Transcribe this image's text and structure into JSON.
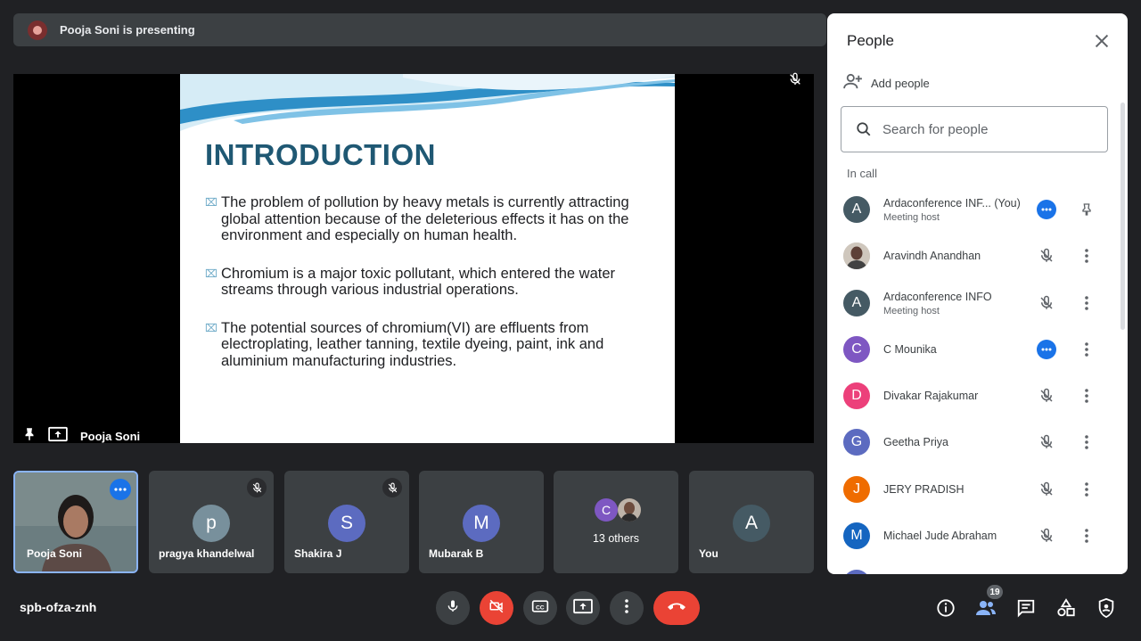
{
  "banner": {
    "text": "Pooja Soni is presenting"
  },
  "slide": {
    "title": "INTRODUCTION",
    "bullets": [
      "The problem of pollution by heavy metals is currently attracting global attention because of the deleterious effects it has on the environment and especially on human health.",
      "Chromium is a major toxic pollutant, which entered the water streams through various industrial operations.",
      "The potential sources of chromium(VI) are effluents from electroplating, leather tanning, textile dyeing, paint, ink and aluminium manufacturing industries."
    ],
    "bullet_mark": "⌧"
  },
  "stage": {
    "presenter_name": "Pooja Soni"
  },
  "tiles": [
    {
      "name": "Pooja Soni"
    },
    {
      "name": "pragya khandelwal",
      "initial": "p",
      "color": "#78909c"
    },
    {
      "name": "Shakira J",
      "initial": "S",
      "color": "#5c6bc0"
    },
    {
      "name": "Mubarak B",
      "initial": "M",
      "color": "#5c6bc0"
    },
    {
      "name": "13 others",
      "initial": "C",
      "color": "#7e57c2"
    },
    {
      "name": "You",
      "initial": "A",
      "color": "#455a64"
    }
  ],
  "bottom": {
    "meeting_code": "spb-ofza-znh",
    "people_count": "19"
  },
  "panel": {
    "title": "People",
    "add_people": "Add people",
    "search_placeholder": "Search for people",
    "in_call": "In call",
    "participants": [
      {
        "name": "Ardaconference INF... (You)",
        "sub": "Meeting host",
        "initial": "A",
        "color": "#455a64"
      },
      {
        "name": "Aravindh Anandhan",
        "sub": "",
        "initial": "",
        "color": "#8d6e63"
      },
      {
        "name": "Ardaconference INFO",
        "sub": "Meeting host",
        "initial": "A",
        "color": "#455a64"
      },
      {
        "name": "C Mounika",
        "sub": "",
        "initial": "C",
        "color": "#7e57c2"
      },
      {
        "name": "Divakar Rajakumar",
        "sub": "",
        "initial": "D",
        "color": "#ec407a"
      },
      {
        "name": "Geetha Priya",
        "sub": "",
        "initial": "G",
        "color": "#5c6bc0"
      },
      {
        "name": "JERY PRADISH",
        "sub": "",
        "initial": "J",
        "color": "#ef6c00"
      },
      {
        "name": "Michael Jude Abraham",
        "sub": "",
        "initial": "M",
        "color": "#1565c0"
      }
    ]
  },
  "colors": {
    "accent": "#1a73e8",
    "leave": "#ea4335",
    "background": "#202124",
    "tile": "#3c4043"
  }
}
